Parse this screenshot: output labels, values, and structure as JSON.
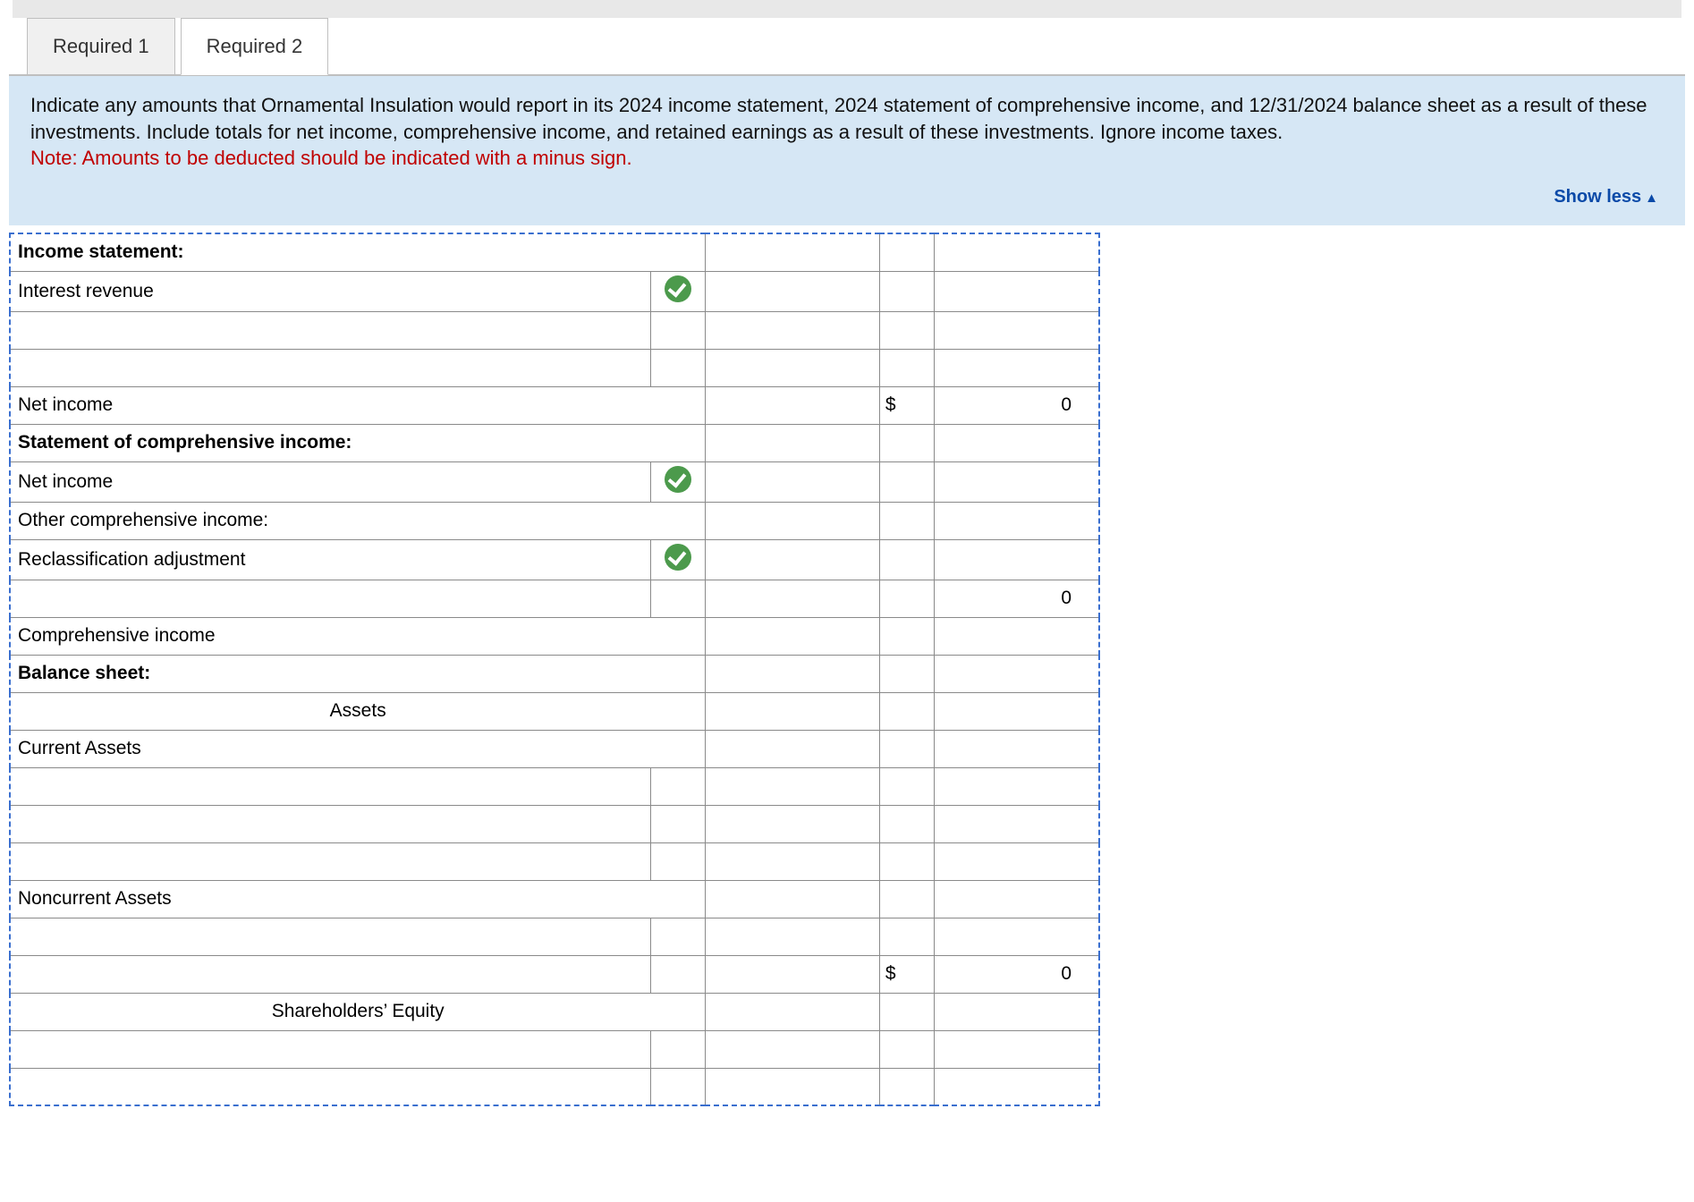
{
  "tabs": {
    "t1": "Required 1",
    "t2": "Required 2"
  },
  "intro": {
    "text": "Indicate any amounts that Ornamental Insulation would report in its 2024 income statement, 2024 statement of comprehensive income, and 12/31/2024 balance sheet as a result of these investments. Include totals for net income, comprehensive income, and retained earnings as a result of these investments. Ignore income taxes.",
    "note": "Note: Amounts to be deducted should be indicated with a minus sign."
  },
  "showless": "Show less",
  "rows": {
    "income_stmt_header": "Income statement:",
    "interest_revenue": "Interest revenue",
    "net_income": "Net income",
    "net_income_dollar": "$",
    "net_income_val": "0",
    "sci_header": "Statement of comprehensive income:",
    "sci_net_income": "Net income",
    "oci": "Other comprehensive income:",
    "reclass": "Reclassification adjustment",
    "sci_total_val": "0",
    "comp_income": "Comprehensive income",
    "bs_header": "Balance sheet:",
    "assets": "Assets",
    "current_assets": "Current Assets",
    "noncurrent_assets": "Noncurrent Assets",
    "nc_dollar": "$",
    "nc_val": "0",
    "se": "Shareholders’ Equity"
  }
}
